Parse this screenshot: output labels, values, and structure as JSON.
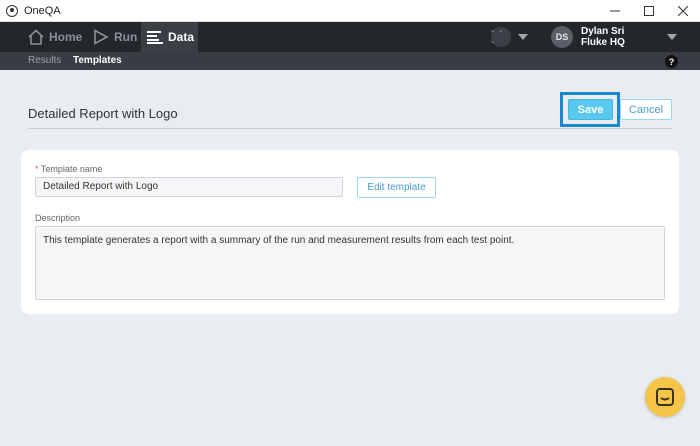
{
  "window": {
    "title": "OneQA"
  },
  "nav": {
    "items": [
      {
        "label": "Home",
        "icon": "home-icon"
      },
      {
        "label": "Run",
        "icon": "play-icon"
      },
      {
        "label": "Data",
        "icon": "data-lines-icon"
      }
    ],
    "status_text": "- - -",
    "user": {
      "initials": "DS",
      "name": "Dylan Sri",
      "org": "Fluke HQ"
    }
  },
  "subnav": {
    "items": [
      {
        "label": "Results"
      },
      {
        "label": "Templates"
      }
    ],
    "help": "?"
  },
  "page": {
    "title": "Detailed Report with Logo",
    "save_label": "Save",
    "cancel_label": "Cancel"
  },
  "form": {
    "required_mark": "*",
    "template_name_label": "Template name",
    "template_name_value": "Detailed Report with Logo",
    "edit_template_label": "Edit template",
    "description_label": "Description",
    "description_value": "This template generates a report with a summary of the run and measurement results from each test point."
  },
  "colors": {
    "accent": "#58c8ef",
    "highlight": "#1a86d6",
    "nav_bg": "#23272c",
    "chat": "#f5c54a"
  }
}
